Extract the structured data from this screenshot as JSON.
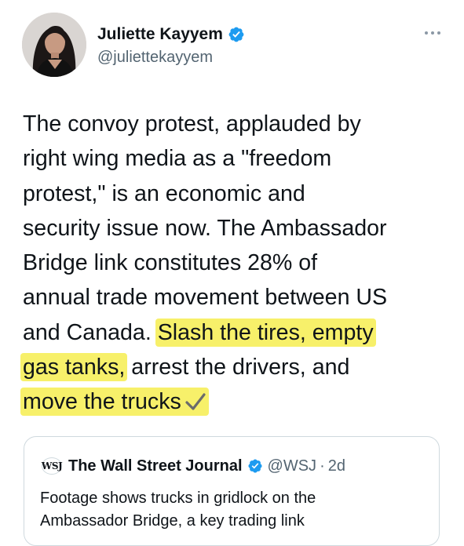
{
  "tweet": {
    "author": {
      "name": "Juliette Kayyem",
      "handle": "@juliettekayyem",
      "verified_icon": "verified-badge-icon",
      "avatar_icon": "profile-photo"
    },
    "more_icon": "more-options-icon",
    "text_lines": [
      "The convoy protest, applauded by",
      "right wing media as a \"freedom",
      "protest,\" is an economic and",
      "security issue now. The Ambassador",
      "Bridge link constitutes 28% of",
      "annual trade movement between US"
    ],
    "line7": {
      "plain": "and Canada. ",
      "highlighted": "Slash the tires, empty"
    },
    "line8": {
      "highlighted": "gas tanks,",
      "plain": " arrest the drivers, and"
    },
    "line9": {
      "highlighted": "move the trucks"
    },
    "highlight_color": "#f7f06a",
    "checkmark_icon": "check-mark-icon"
  },
  "quoted_tweet": {
    "logo_text": "WSJ",
    "name": "The Wall Street Journal",
    "handle": "@WSJ",
    "separator": "·",
    "time": "2d",
    "text_lines": [
      "Footage shows trucks in gridlock on the",
      "Ambassador Bridge, a key trading link"
    ]
  },
  "colors": {
    "text": "#0f1419",
    "secondary": "#536471",
    "verified_blue": "#1d9bf0",
    "border": "#cfd9de"
  }
}
